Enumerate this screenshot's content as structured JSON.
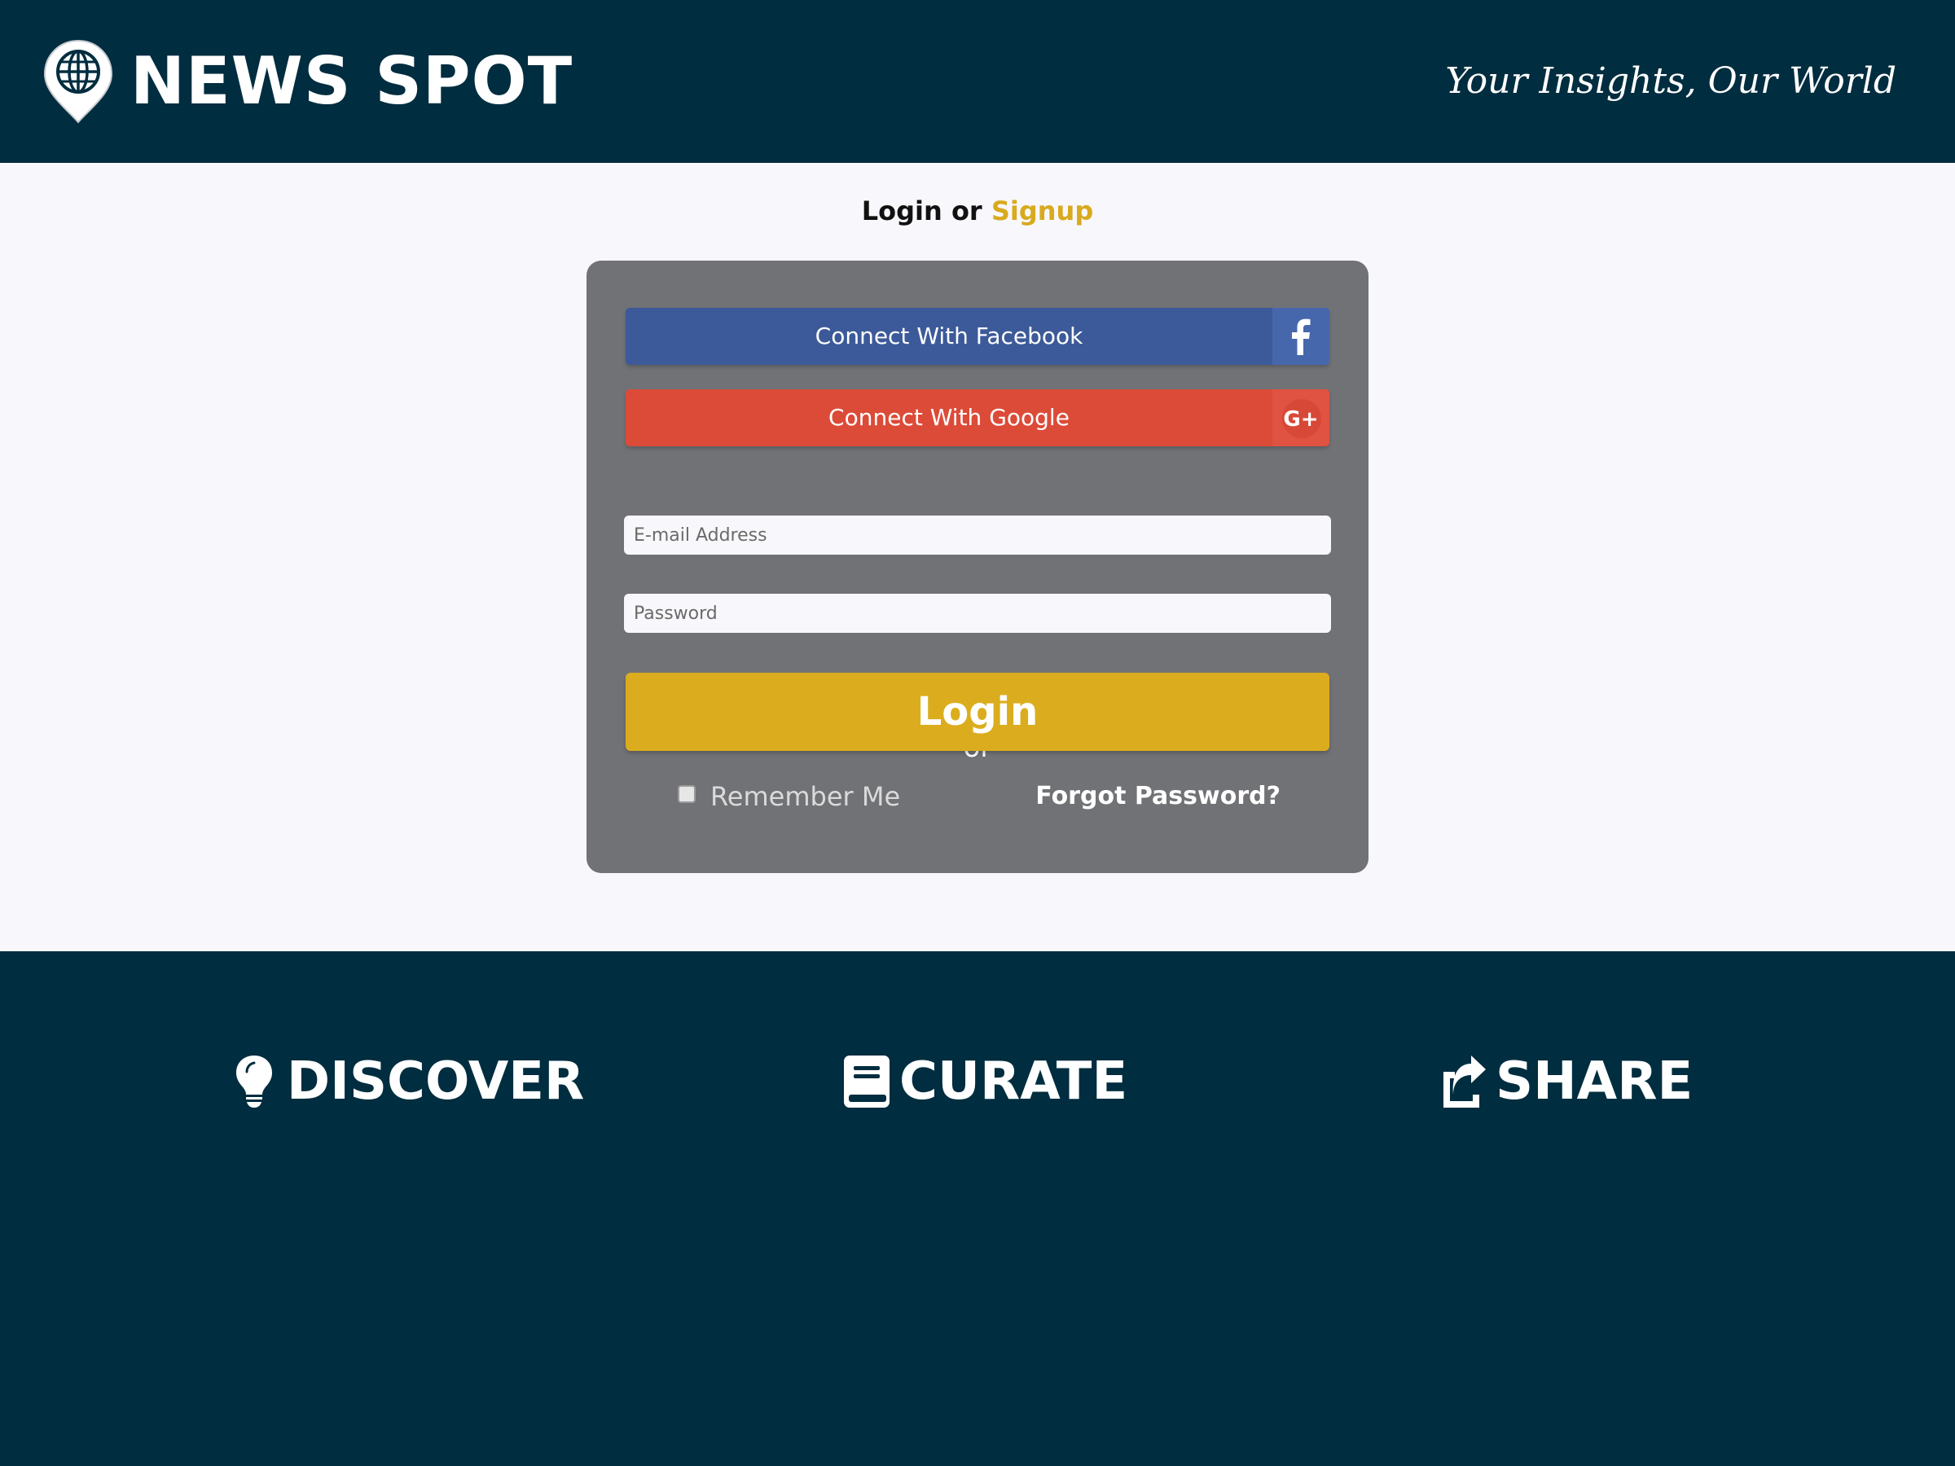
{
  "header": {
    "brand": "NEWS SPOT",
    "tagline": "Your Insights, Our World",
    "logo_icon": "globe-pin-icon",
    "bg_color": "#002d3f"
  },
  "main": {
    "heading_login": "Login",
    "heading_or": "or",
    "heading_signup": "Signup",
    "facebook_label": "Connect With Facebook",
    "google_label": "Connect With Google",
    "google_icon_text": "G+",
    "or_label": "or",
    "email_placeholder": "E-mail Address",
    "password_placeholder": "Password",
    "login_label": "Login",
    "remember_label": "Remember Me",
    "remember_checked": false,
    "forgot_label": "Forgot Password?",
    "colors": {
      "accent": "#dbad1e",
      "facebook": "#3c5a99",
      "google": "#dc4b38",
      "panel": "#717276"
    }
  },
  "footer": {
    "features": [
      {
        "label": "DISCOVER",
        "icon": "lightbulb-icon"
      },
      {
        "label": "CURATE",
        "icon": "book-icon"
      },
      {
        "label": "SHARE",
        "icon": "share-icon"
      }
    ]
  }
}
